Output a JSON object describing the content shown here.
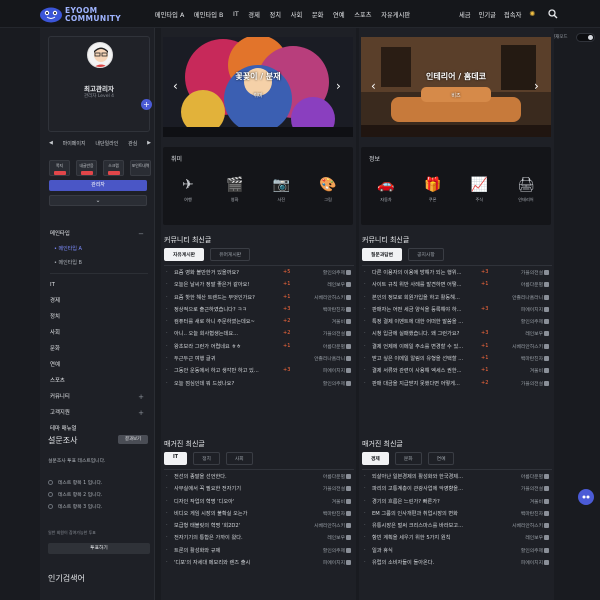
{
  "logo": {
    "line1": "EYOOM",
    "line2": "COMMUNITY"
  },
  "nav": {
    "items": [
      "메인타입 A",
      "메인타입 B",
      "IT",
      "경제",
      "정치",
      "사회",
      "문화",
      "연예",
      "스포츠",
      "자유게시판"
    ],
    "right": [
      "세금",
      "인기글",
      "접속자"
    ]
  },
  "darkmode_label": "현재모드",
  "profile": {
    "name": "최고관리자",
    "level": "관리자 Level 4",
    "tabs": [
      "마이페이지",
      "내단일라인",
      "관심"
    ],
    "buttons": [
      "쪽지",
      "내글반응",
      "스크랩",
      "포인트내역"
    ],
    "admin": "관리자"
  },
  "menu": {
    "main": "메인타입",
    "subs": [
      "메인타입 A",
      "메인타입 B"
    ],
    "items": [
      "IT",
      "경제",
      "정치",
      "사회",
      "문화",
      "연예",
      "스포츠"
    ],
    "items2": [
      "커뮤니티",
      "고객지원",
      "테마 매뉴얼"
    ]
  },
  "survey": {
    "title": "설문조사",
    "button": "결과보기",
    "question": "설문조사 투표 테스트입니다.",
    "options": [
      "테스트 항목 1 입니다.",
      "테스트 항목 2 입니다.",
      "테스트 항목 3 입니다."
    ],
    "note": "일반 회원이 참여가능한 투표",
    "vote": "투표하기"
  },
  "popular": {
    "title": "인기검색어"
  },
  "cards": [
    {
      "title": "꽃꽂이 / 분재",
      "sub": "취미"
    },
    {
      "title": "인테리어 / 홈데코",
      "sub": "비즈"
    }
  ],
  "cats": [
    {
      "title": "취미",
      "items": [
        {
          "icon": "✈",
          "label": "여행"
        },
        {
          "icon": "🎬",
          "label": "영화"
        },
        {
          "icon": "📷",
          "label": "사진"
        },
        {
          "icon": "🎨",
          "label": "그림"
        }
      ]
    },
    {
      "title": "정보",
      "items": [
        {
          "icon": "🚗",
          "label": "자동차"
        },
        {
          "icon": "🎁",
          "label": "쿠폰"
        },
        {
          "icon": "📈",
          "label": "주식"
        },
        {
          "icon": "🖨",
          "label": "인테리어"
        }
      ]
    }
  ],
  "community": [
    {
      "title": "커뮤니티 최신글",
      "tabs": [
        "자유게시판",
        "유머게시판"
      ],
      "rows": [
        {
          "t": "요즘 영화 볼만한거 있을까요?",
          "c": "+5",
          "a": "할인의주제"
        },
        {
          "t": "오늘은 날씨가 정말 좋은거 같아요!",
          "c": "+1",
          "a": "레인보우"
        },
        {
          "t": "요즘 핫한 해산 트렌드는 무엇인가요?",
          "c": "+1",
          "a": "시베리안허스키"
        },
        {
          "t": "정상적으로 출근하였습니다? ㅋㅋ",
          "c": "+3",
          "a": "백마탄친자"
        },
        {
          "t": "컴퓨터를 새로 하니 주문하였는데요~",
          "c": "+2",
          "a": "겨울비"
        },
        {
          "t": "아니.. 오늘 회사협생는데요...",
          "c": "+2",
          "a": "가을의전설"
        },
        {
          "t": "왕초보라 그런가 어렵네요 ㅎㅎ",
          "c": "+1",
          "a": "아름다운별"
        },
        {
          "t": "두근두근 여행 글귀",
          "c": "",
          "a": "안졸리나홈라니"
        },
        {
          "t": "그동안 운동에서 하고 생각만 하고 있...",
          "c": "+3",
          "a": "피에이치지"
        },
        {
          "t": "오늘 점심인데 뭐 드셨나요?",
          "c": "",
          "a": "할인의주제"
        }
      ]
    },
    {
      "title": "커뮤니티 최신글",
      "tabs": [
        "질문과답변",
        "공지사항"
      ],
      "rows": [
        {
          "t": "다른 이용자의 이용에 방해가 되는 행위...",
          "c": "+3",
          "a": "가을의전설"
        },
        {
          "t": "사이트 규칙 위반 사례를 발견하면 어떻...",
          "c": "+1",
          "a": "아름다운별"
        },
        {
          "t": "본인의 정보로 회원가입을 하고 활동해...",
          "c": "",
          "a": "안졸리나홈라니"
        },
        {
          "t": "판매자는 어떤 세금 양식을 등록해야 하...",
          "c": "+3",
          "a": "피에이치지"
        },
        {
          "t": "특정 결제 이벤트에 대한 어떠한 말씀을 ...",
          "c": "",
          "a": "할인의주제"
        },
        {
          "t": "시청 입금에 실패했습니다. 왜 그런가요?",
          "c": "+3",
          "a": "레인보우"
        },
        {
          "t": "결제 언제에 이메일 주소를 변경할 수 있...",
          "c": "+1",
          "a": "시베리안허스키"
        },
        {
          "t": "받고 싶은 이메일 알림의 유형을 선택할 ...",
          "c": "+1",
          "a": "백마탄친자"
        },
        {
          "t": "결제 서류와 관련이 사용해 엑세스 권한...",
          "c": "+1",
          "a": "겨울비"
        },
        {
          "t": "판매 대금을 지급받지 못했다면 어떻게...",
          "c": "+2",
          "a": "가을의전설"
        }
      ]
    },
    {
      "title": "매거진 최신글",
      "tabs": [
        "IT",
        "정치",
        "사회"
      ],
      "rows": [
        {
          "t": "전선의 종말을 선언한다.",
          "c": "",
          "a": "아름다운별"
        },
        {
          "t": "사무실에서 꼭 필요한 전자기기",
          "c": "",
          "a": "가을의전설"
        },
        {
          "t": "디자인 작업의 혁명 '디오아'",
          "c": "",
          "a": "겨울비"
        },
        {
          "t": "비디오 게임 시장의 불확실 오는가",
          "c": "",
          "a": "백마탄친자"
        },
        {
          "t": "보급형 태블릿의 혁명 '회2D2'",
          "c": "",
          "a": "시베리안허스키"
        },
        {
          "t": "전자기기의 통합은 가까이 왔다.",
          "c": "",
          "a": "레인보우"
        },
        {
          "t": "트론의 활성화와 규제",
          "c": "",
          "a": "할인의주제"
        },
        {
          "t": "'디포'의 자세대 메모리와 렌즈 출시",
          "c": "",
          "a": "피에이치지"
        }
      ]
    },
    {
      "title": "매거진 최신글",
      "tabs": [
        "경제",
        "문화",
        "연예"
      ],
      "rows": [
        {
          "t": "되살아난 일본경제의 활성화와 한국경제...",
          "c": "",
          "a": "아름다운별"
        },
        {
          "t": "파리의 고통계층이 관광사업에 악영향을...",
          "c": "",
          "a": "가을의전설"
        },
        {
          "t": "경기의 흐름은 느린가? 빠른가?",
          "c": "",
          "a": "겨울비"
        },
        {
          "t": "EM 그룹의 인사개편과 취업시장의 변화",
          "c": "",
          "a": "백마탄친자"
        },
        {
          "t": "유통시장은 벌써 크리스마스를 바라보고...",
          "c": "",
          "a": "시베리안허스키"
        },
        {
          "t": "항빈 계획을 세우기 위한 5가지 원칙",
          "c": "",
          "a": "레인보우"
        },
        {
          "t": "일과 휴식",
          "c": "",
          "a": "할인의주제"
        },
        {
          "t": "유럽의 소비자들이 돌아온다.",
          "c": "",
          "a": "피에이치지"
        }
      ]
    }
  ]
}
